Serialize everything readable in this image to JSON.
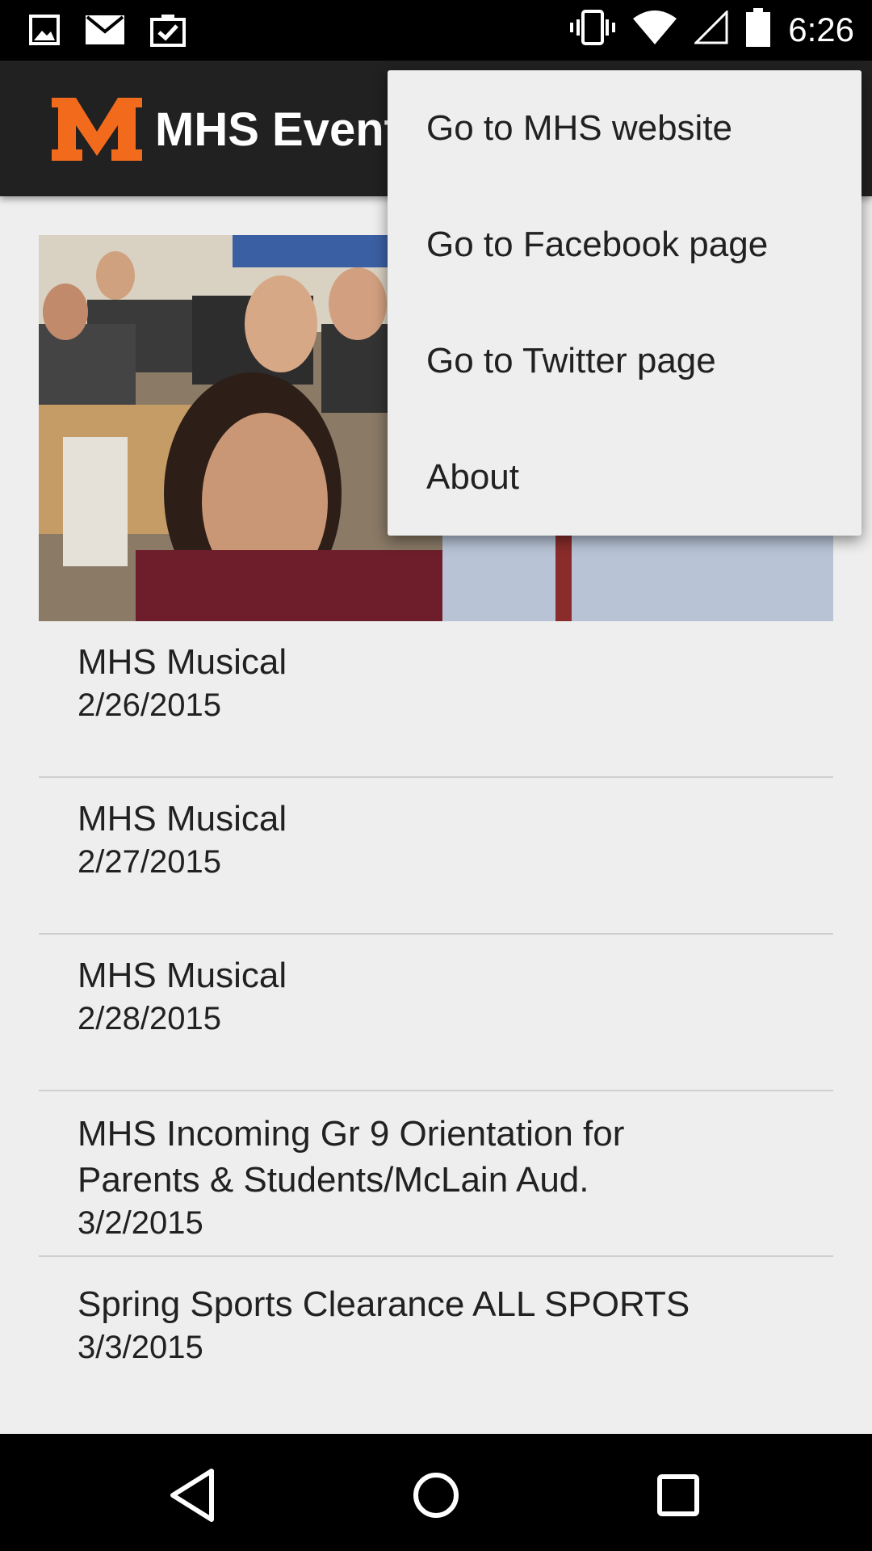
{
  "status_bar": {
    "time": "6:26",
    "left_icons": [
      "image-icon",
      "mail-icon",
      "clipboard-check-icon"
    ],
    "right_icons": [
      "vibrate-icon",
      "wifi-icon",
      "signal-icon",
      "battery-icon"
    ]
  },
  "app_bar": {
    "logo_letter": "M",
    "title": "MHS Events",
    "accent_color": "#f26b1d"
  },
  "overflow_menu": {
    "items": [
      {
        "label": "Go to MHS website"
      },
      {
        "label": "Go to Facebook page"
      },
      {
        "label": "Go to Twitter page"
      },
      {
        "label": "About"
      }
    ]
  },
  "events": [
    {
      "title": "MHS Musical",
      "date": "2/26/2015"
    },
    {
      "title": "MHS Musical",
      "date": "2/27/2015"
    },
    {
      "title": "MHS Musical",
      "date": "2/28/2015"
    },
    {
      "title": "MHS Incoming Gr 9 Orientation for Parents & Students/McLain Aud.",
      "date": "3/2/2015"
    },
    {
      "title": "Spring Sports Clearance ALL SPORTS",
      "date": "3/3/2015"
    }
  ],
  "nav_bar": {
    "buttons": [
      "back-icon",
      "home-icon",
      "recents-icon"
    ]
  }
}
